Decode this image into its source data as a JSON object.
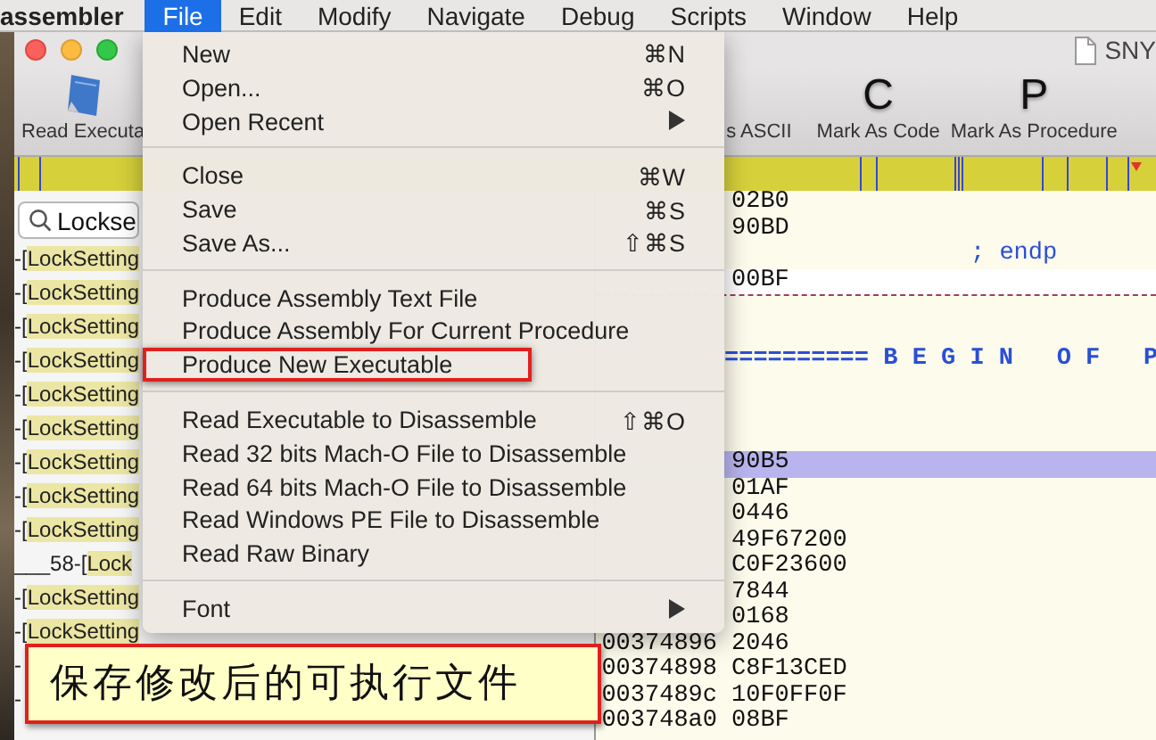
{
  "menubar": {
    "app_name": "assembler",
    "items": [
      {
        "label": "File",
        "selected": true
      },
      {
        "label": "Edit",
        "selected": false
      },
      {
        "label": "Modify",
        "selected": false
      },
      {
        "label": "Navigate",
        "selected": false
      },
      {
        "label": "Debug",
        "selected": false
      },
      {
        "label": "Scripts",
        "selected": false
      },
      {
        "label": "Window",
        "selected": false
      },
      {
        "label": "Help",
        "selected": false
      }
    ]
  },
  "window": {
    "title": "SNY"
  },
  "toolbar": {
    "buttons": [
      {
        "kind": "image",
        "label": "Read Executa"
      },
      {
        "kind": "text",
        "label": "s ASCII"
      },
      {
        "kind": "letter",
        "glyph": "C",
        "label": "Mark As Code"
      },
      {
        "kind": "letter",
        "glyph": "P",
        "label": "Mark As Procedure"
      }
    ]
  },
  "sidebar": {
    "search": {
      "value": "Lockse"
    },
    "items": [
      {
        "prefix": "-[",
        "match": "LockSetting"
      },
      {
        "prefix": "-[",
        "match": "LockSetting"
      },
      {
        "prefix": "-[",
        "match": "LockSetting"
      },
      {
        "prefix": "-[",
        "match": "LockSetting"
      },
      {
        "prefix": "-[",
        "match": "LockSetting"
      },
      {
        "prefix": "-[",
        "match": "LockSetting"
      },
      {
        "prefix": "-[",
        "match": "LockSetting"
      },
      {
        "prefix": "-[",
        "match": "LockSetting"
      },
      {
        "prefix": "-[",
        "match": "LockSetting"
      },
      {
        "prefix": "___58-[",
        "match": "Lock"
      },
      {
        "prefix": "-[",
        "match": "LockSetting"
      },
      {
        "prefix": "-[",
        "match": "LockSetting"
      },
      {
        "prefix": "-"
      },
      {
        "prefix": "-"
      }
    ]
  },
  "code": {
    "rows": [
      {
        "kind": "code",
        "bytes": "02B0",
        "selected": false,
        "current": false,
        "divider_after": false
      },
      {
        "kind": "code",
        "bytes": "90BD",
        "selected": false,
        "current": false,
        "divider_after": false
      },
      {
        "kind": "comment",
        "text": "; endp"
      },
      {
        "kind": "code",
        "bytes": "00BF",
        "selected": false,
        "current": true,
        "divider_after": true
      },
      {
        "kind": "blank"
      },
      {
        "kind": "blank"
      },
      {
        "kind": "banner",
        "text": "========== B E G I N   O F   P"
      },
      {
        "kind": "blank"
      },
      {
        "kind": "blank"
      },
      {
        "kind": "blank"
      },
      {
        "kind": "code",
        "bytes": "90B5",
        "selected": true,
        "current": false,
        "divider_after": false
      },
      {
        "kind": "code",
        "bytes": "01AF",
        "selected": false,
        "current": false,
        "divider_after": false
      },
      {
        "kind": "code",
        "bytes": "0446",
        "selected": false,
        "current": false,
        "divider_after": false
      },
      {
        "kind": "code",
        "bytes": "49F67200",
        "selected": false,
        "current": false,
        "divider_after": false
      },
      {
        "kind": "code",
        "bytes": "C0F23600",
        "selected": false,
        "current": false,
        "divider_after": false
      },
      {
        "kind": "code",
        "bytes": "7844",
        "selected": false,
        "current": false,
        "divider_after": false
      },
      {
        "kind": "code",
        "bytes": "0168",
        "selected": false,
        "current": false,
        "divider_after": false
      },
      {
        "kind": "code",
        "address": "00374896",
        "bytes": "2046",
        "selected": false,
        "current": false,
        "divider_after": false
      },
      {
        "kind": "code",
        "address": "00374898",
        "bytes": "C8F13CED",
        "selected": false,
        "current": false,
        "divider_after": false
      },
      {
        "kind": "code",
        "address": "0037489c",
        "bytes": "10F0FF0F",
        "selected": false,
        "current": false,
        "divider_after": false
      },
      {
        "kind": "code",
        "address": "003748a0",
        "bytes": "08BF",
        "selected": false,
        "current": false,
        "divider_after": false
      }
    ]
  },
  "file_menu": {
    "items": [
      {
        "kind": "item",
        "label": "New",
        "shortcut": "⌘N",
        "submenu": false,
        "annotated": false
      },
      {
        "kind": "item",
        "label": "Open...",
        "shortcut": "⌘O",
        "submenu": false,
        "annotated": false
      },
      {
        "kind": "item",
        "label": "Open Recent",
        "submenu": true,
        "annotated": false
      },
      {
        "kind": "separator"
      },
      {
        "kind": "item",
        "label": "Close",
        "shortcut": "⌘W",
        "submenu": false,
        "annotated": false
      },
      {
        "kind": "item",
        "label": "Save",
        "shortcut": "⌘S",
        "submenu": false,
        "annotated": false
      },
      {
        "kind": "item",
        "label": "Save As...",
        "shortcut": "⇧⌘S",
        "submenu": false,
        "annotated": false
      },
      {
        "kind": "separator"
      },
      {
        "kind": "item",
        "label": "Produce Assembly Text File",
        "submenu": false,
        "annotated": false
      },
      {
        "kind": "item",
        "label": "Produce Assembly For Current Procedure",
        "submenu": false,
        "annotated": false
      },
      {
        "kind": "item",
        "label": "Produce New Executable",
        "submenu": false,
        "annotated": true
      },
      {
        "kind": "separator"
      },
      {
        "kind": "item",
        "label": "Read Executable to Disassemble",
        "shortcut": "⇧⌘O",
        "submenu": false,
        "annotated": false
      },
      {
        "kind": "item",
        "label": "Read 32 bits Mach-O File to Disassemble",
        "submenu": false,
        "annotated": false
      },
      {
        "kind": "item",
        "label": "Read 64 bits Mach-O File to Disassemble",
        "submenu": false,
        "annotated": false
      },
      {
        "kind": "item",
        "label": "Read Windows PE File to Disassemble",
        "submenu": false,
        "annotated": false
      },
      {
        "kind": "item",
        "label": "Read Raw Binary",
        "submenu": false,
        "annotated": false
      },
      {
        "kind": "separator"
      },
      {
        "kind": "item",
        "label": "Font",
        "submenu": true,
        "annotated": false
      }
    ]
  },
  "caption": {
    "text": "保存修改后的可执行文件"
  }
}
